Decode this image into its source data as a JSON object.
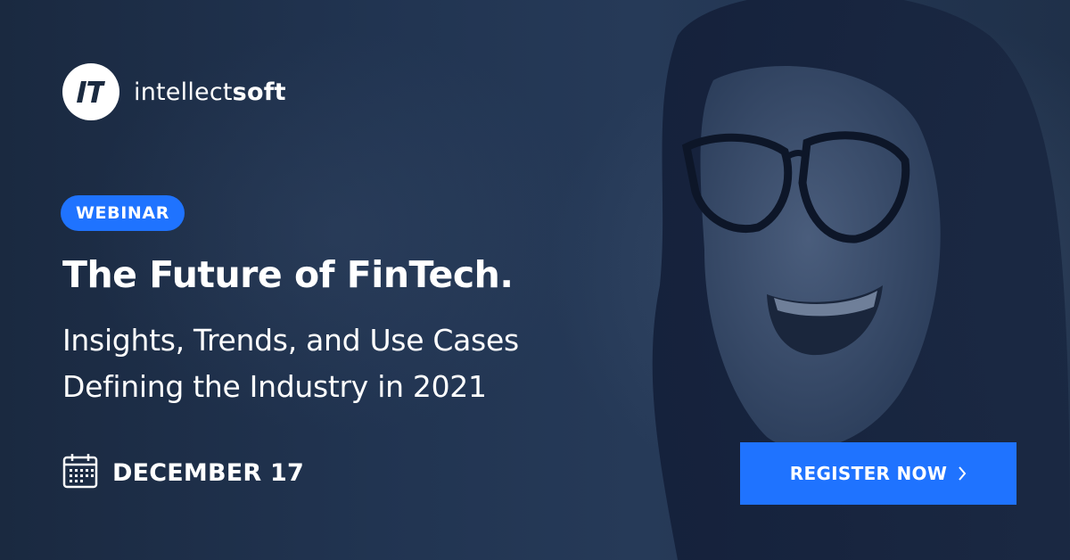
{
  "brand": {
    "name_light": "intellect",
    "name_bold": "soft",
    "logo_glyph": "IT",
    "accent": "#1f73ff"
  },
  "badge": {
    "label": "WEBINAR"
  },
  "headline": {
    "title": "The Future of FinTech.",
    "subtitle_line1": "Insights, Trends, and Use Cases",
    "subtitle_line2": "Defining the Industry in 2021"
  },
  "event": {
    "date": "DECEMBER 17",
    "icon": "calendar-icon"
  },
  "cta": {
    "label": "REGISTER NOW",
    "icon": "chevron-right-icon"
  }
}
